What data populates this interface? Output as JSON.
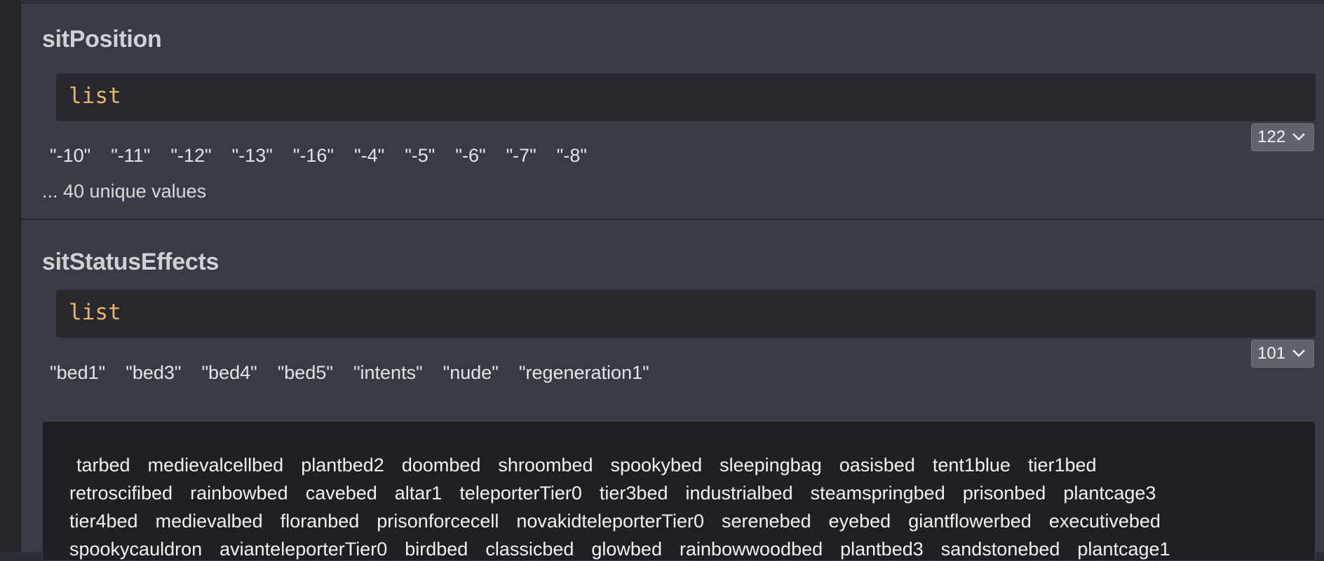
{
  "fields": [
    {
      "name": "sitPosition",
      "type": "list",
      "count": "122",
      "values": [
        "\"-10\"",
        "\"-11\"",
        "\"-12\"",
        "\"-13\"",
        "\"-16\"",
        "\"-4\"",
        "\"-5\"",
        "\"-6\"",
        "\"-7\"",
        "\"-8\""
      ],
      "unique_note": "... 40 unique values"
    },
    {
      "name": "sitStatusEffects",
      "type": "list",
      "count": "101",
      "values": [
        "\"bed1\"",
        "\"bed3\"",
        "\"bed4\"",
        "\"bed5\"",
        "\"intents\"",
        "\"nude\"",
        "\"regeneration1\""
      ],
      "sample_lines": [
        [
          "tarbed",
          "medievalcellbed",
          "plantbed2",
          "doombed",
          "shroombed",
          "spookybed",
          "sleepingbag",
          "oasisbed",
          "tent1blue",
          "tier1bed"
        ],
        [
          "retroscifibed",
          "rainbowbed",
          "cavebed",
          "altar1",
          "teleporterTier0",
          "tier3bed",
          "industrialbed",
          "steamspringbed",
          "prisonbed",
          "plantcage3"
        ],
        [
          "tier4bed",
          "medievalbed",
          "floranbed",
          "prisonforcecell",
          "novakidteleporterTier0",
          "serenebed",
          "eyebed",
          "giantflowerbed",
          "executivebed"
        ],
        [
          "spookycauldron",
          "avianteleporterTier0",
          "birdbed",
          "classicbed",
          "glowbed",
          "rainbowwoodbed",
          "plantbed3",
          "sandstonebed",
          "plantcage1"
        ]
      ]
    }
  ],
  "icons": {
    "badge_chevron": "chevron-down-icon"
  },
  "colors": {
    "type_text": "#e8b663",
    "panel_bg": "#373b42",
    "code_bg": "#26282d",
    "badge_bg": "#5f646b"
  }
}
